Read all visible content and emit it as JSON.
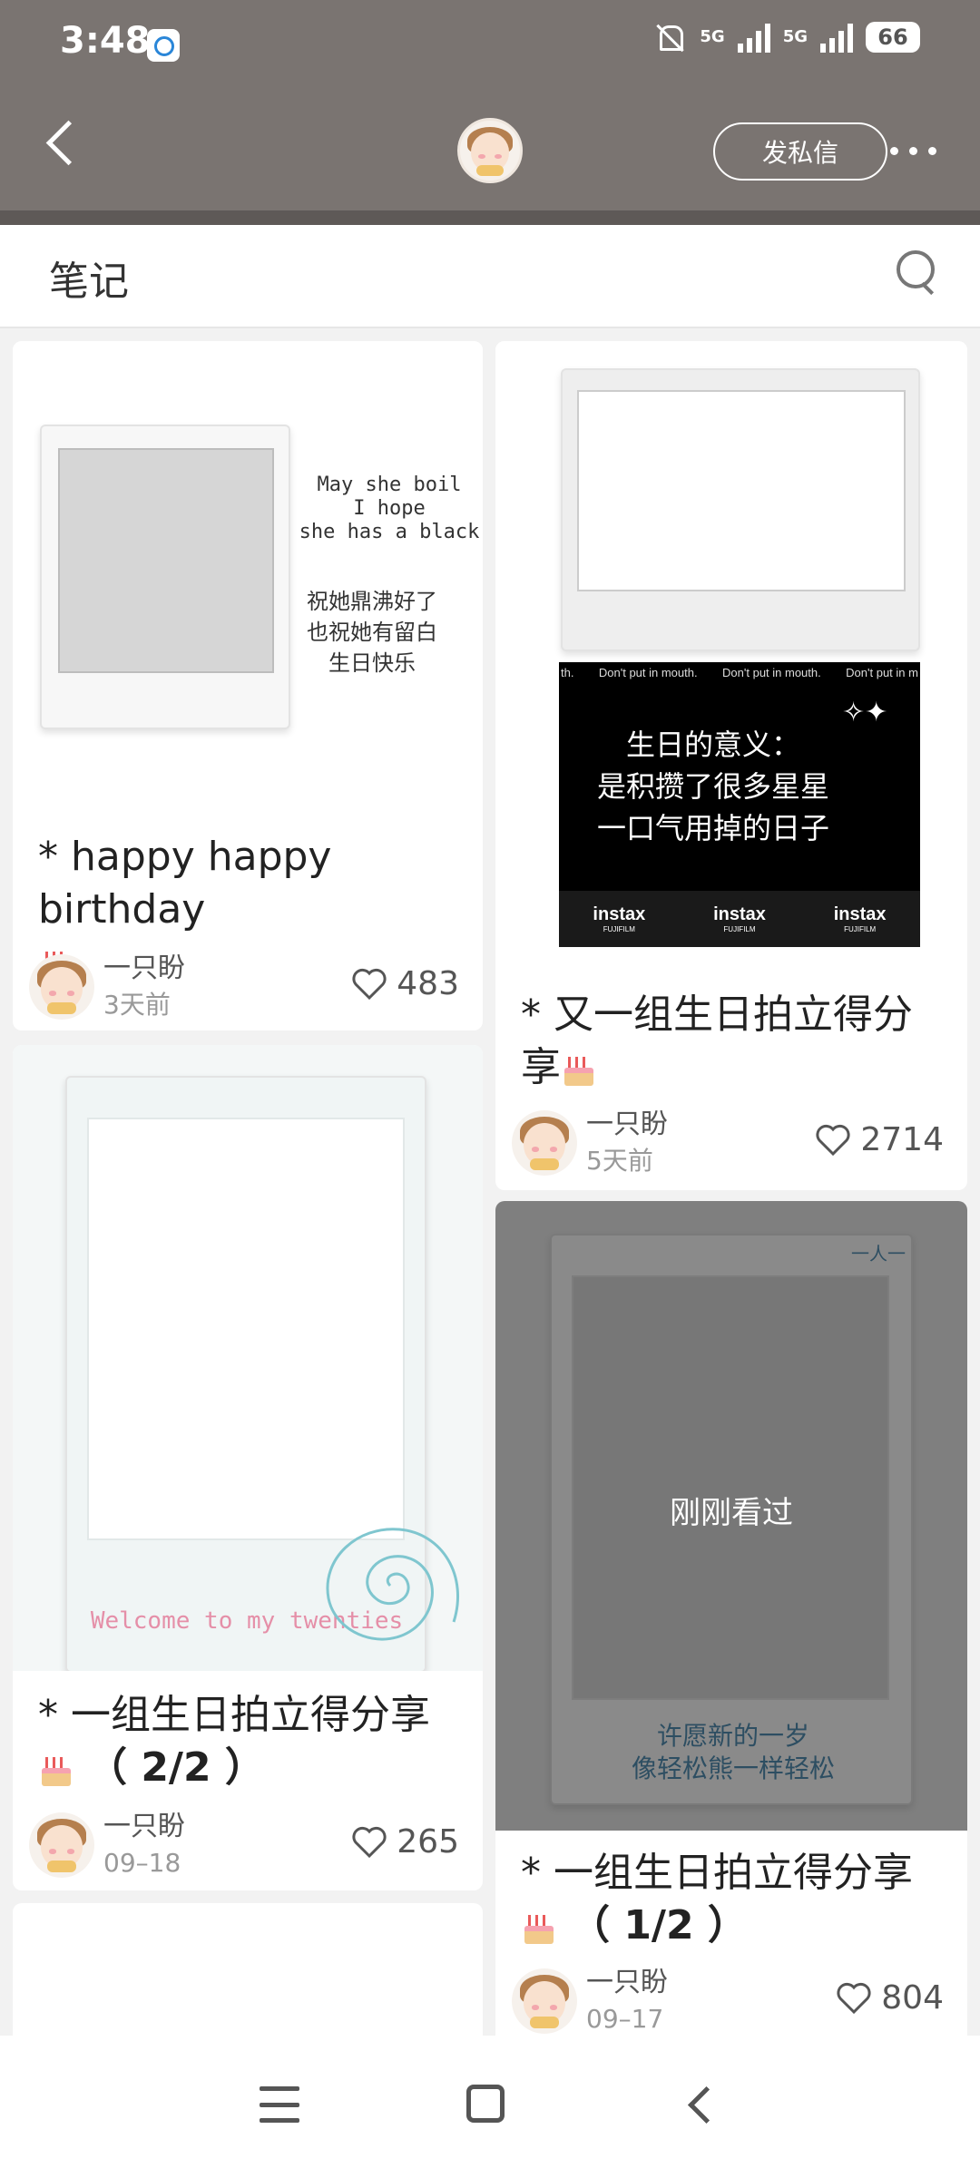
{
  "status_bar": {
    "time": "3:48",
    "network_1": "5G",
    "network_2": "5G",
    "battery": "66",
    "icons": [
      "app-badge-icon",
      "mute-icon",
      "signal-icon",
      "battery-icon"
    ]
  },
  "header": {
    "dm_button": "发私信",
    "icons": [
      "back-icon",
      "avatar",
      "more-icon"
    ]
  },
  "tab": {
    "title": "笔记",
    "icons": [
      "search-icon"
    ]
  },
  "cards": [
    {
      "caption": "* happy happy birthday",
      "author": "一只盼",
      "date": "3天前",
      "likes": "483",
      "image_text": {
        "en_line1": "May she boil",
        "en_line2": "I hope",
        "en_line3": "she has a black",
        "zh_line1": "祝她鼎沸好了",
        "zh_line2": "也祝她有留白",
        "zh_line3": "生日快乐"
      }
    },
    {
      "caption_line1": "* 又一组生日拍立得分",
      "caption_line2": "享",
      "author": "一只盼",
      "date": "5天前",
      "likes": "2714",
      "image_text": {
        "strip_text": "Don't put in mouth.",
        "strip_prefix": "th.",
        "strip_suffix": "Don't put in m",
        "zh_line1": "生日的意义：",
        "zh_line2": "是积攒了很多星星",
        "zh_line3": "一口气用掉的日子",
        "brand": "instax",
        "sub_brand": "FUJIFILM"
      }
    },
    {
      "caption_line1": "* 一组生日拍立得分享",
      "caption_line2": "（ 2/2 ）",
      "author": "一只盼",
      "date": "09–18",
      "likes": "265",
      "image_text": {
        "welcome": "Welcome to my twenties"
      }
    },
    {
      "caption_line1": "* 一组生日拍立得分享",
      "caption_line2": "（ 1/2 ）",
      "author": "一只盼",
      "date": "09–17",
      "likes": "804",
      "overlay": "刚刚看过",
      "image_text": {
        "corner": "一人一",
        "zh_line1": "许愿新的一岁",
        "zh_line2": "像轻松熊一样轻松"
      }
    }
  ],
  "nav_bar": {
    "icons": [
      "menu-icon",
      "home-icon",
      "back-icon"
    ]
  },
  "colors": {
    "header_bg": "#7a7471",
    "card_bg": "#ffffff",
    "page_bg": "#f2f2f2",
    "overlay_bg": "#7f7f7f"
  }
}
